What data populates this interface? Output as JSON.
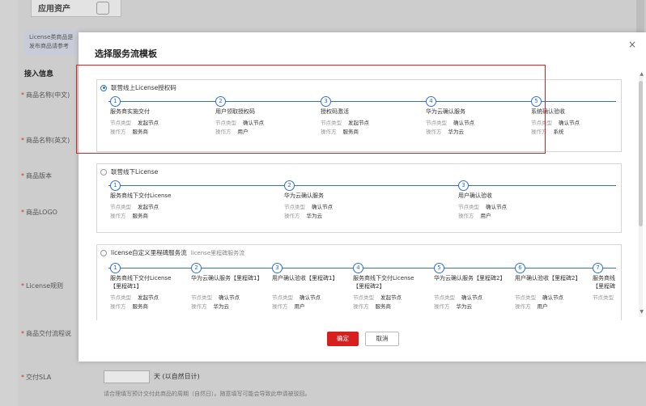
{
  "background": {
    "top_tab": "应用资产",
    "note_line1": "License类商品是",
    "note_line2": "发布商品请参考",
    "section_title": "接入信息",
    "labels": [
      "商品名称(中文)",
      "商品名称(英文)",
      "商品版本",
      "商品LOGO",
      "License规则",
      "商品交付流程说",
      "交付SLA"
    ],
    "sla_unit": "天  (以自然日计)",
    "sla_hint": "请合理填写预计交付此商品的周期（自然日）。随意填写可能会导致此申请被驳回。"
  },
  "modal": {
    "title": "选择服务流模板",
    "close": "×",
    "ok": "确定",
    "cancel": "取消",
    "kv_type_label": "节点类型",
    "kv_op_label": "操作方",
    "templates": [
      {
        "title": "联营线上License授权码",
        "subtitle": "",
        "selected": true,
        "steps": [
          {
            "num": "1",
            "name": "服务商实施交付",
            "type": "发起节点",
            "op": "服务商"
          },
          {
            "num": "2",
            "name": "用户领取授权码",
            "type": "确认节点",
            "op": "用户"
          },
          {
            "num": "3",
            "name": "授权码激活",
            "type": "发起节点",
            "op": "服务商"
          },
          {
            "num": "4",
            "name": "华为云确认服务",
            "type": "确认节点",
            "op": "华为云"
          },
          {
            "num": "5",
            "name": "系统确认验收",
            "type": "确认节点",
            "op": "系统"
          }
        ]
      },
      {
        "title": "联营线下License",
        "subtitle": "",
        "selected": false,
        "steps": [
          {
            "num": "1",
            "name": "服务商线下交付License",
            "type": "发起节点",
            "op": "服务商"
          },
          {
            "num": "2",
            "name": "华为云确认服务",
            "type": "确认节点",
            "op": "华为云"
          },
          {
            "num": "3",
            "name": "用户确认验收",
            "type": "确认节点",
            "op": "用户"
          }
        ]
      },
      {
        "title": "license自定义里程碑服务流",
        "subtitle": "license里程碑服务流",
        "selected": false,
        "steps": [
          {
            "num": "1",
            "name": "服务商线下交付License【里程碑1】",
            "type": "发起节点",
            "op": "服务商"
          },
          {
            "num": "2",
            "name": "华为云确认服务【里程碑1】",
            "type": "确认节点",
            "op": "华为云"
          },
          {
            "num": "3",
            "name": "用户确认验收【里程碑1】",
            "type": "确认节点",
            "op": "用户"
          },
          {
            "num": "4",
            "name": "服务商线下交付License【里程碑2】",
            "type": "发起节点",
            "op": "服务商"
          },
          {
            "num": "5",
            "name": "华为云确认服务【里程碑2】",
            "type": "确认节点",
            "op": "华为云"
          },
          {
            "num": "6",
            "name": "用户确认验收【里程碑2】",
            "type": "确认节点",
            "op": "用户"
          },
          {
            "num": "7",
            "name": "服务商线【里程碑",
            "type": "",
            "op": ""
          }
        ]
      }
    ]
  },
  "colors": {
    "accent": "#2f6fd6",
    "danger": "#d62020",
    "highlight": "#e02020"
  }
}
